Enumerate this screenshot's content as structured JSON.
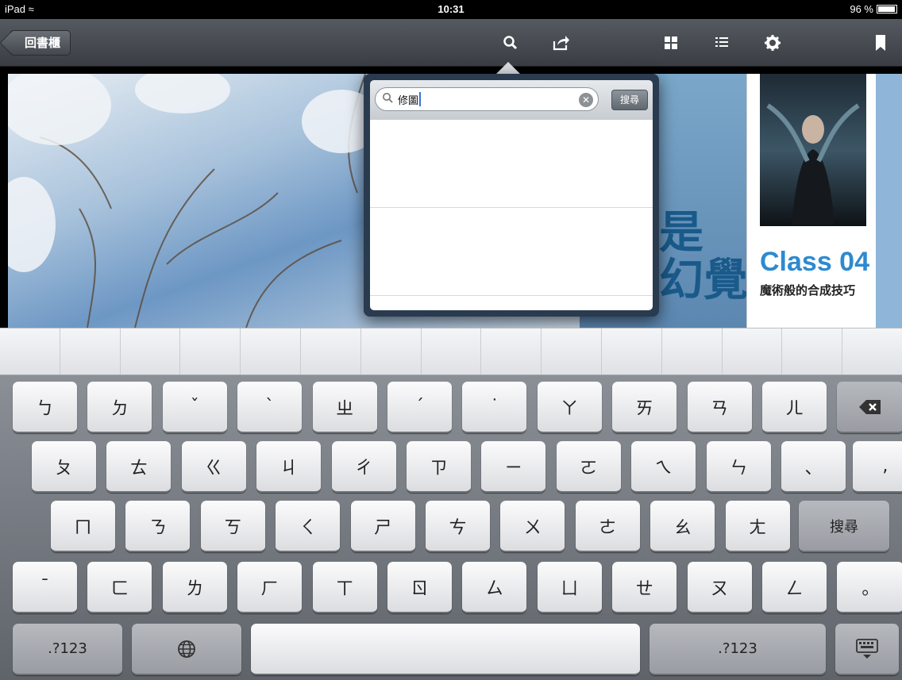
{
  "status_bar": {
    "device": "iPad",
    "time": "10:31",
    "battery": "96 %",
    "battery_level": 0.96
  },
  "toolbar": {
    "back_label": "回書櫃"
  },
  "magazine": {
    "title": "Class 04",
    "subtitle": "魔術般的合成技巧",
    "big_text": "是\n幻覺"
  },
  "search": {
    "query": "修圖",
    "button_label": "搜尋"
  },
  "keyboard": {
    "row1": [
      "ㄅ",
      "ㄉ",
      "ˇ",
      "ˋ",
      "ㄓ",
      "ˊ",
      "˙",
      "ㄚ",
      "ㄞ",
      "ㄢ",
      "ㄦ"
    ],
    "row2": [
      "ㄆ",
      "ㄊ",
      "ㄍ",
      "ㄐ",
      "ㄔ",
      "ㄗ",
      "ㄧ",
      "ㄛ",
      "ㄟ",
      "ㄣ",
      "、",
      ","
    ],
    "row3": [
      "ㄇ",
      "ㄋ",
      "ㄎ",
      "ㄑ",
      "ㄕ",
      "ㄘ",
      "ㄨ",
      "ㄜ",
      "ㄠ",
      "ㄤ"
    ],
    "row3_action": "搜尋",
    "row4": [
      "ˉ",
      "ㄈ",
      "ㄌ",
      "ㄏ",
      "ㄒ",
      "ㄖ",
      "ㄙ",
      "ㄩ",
      "ㄝ",
      "ㄡ",
      "ㄥ",
      "。"
    ],
    "numbers_label_left": ".?123",
    "numbers_label_right": ".?123"
  },
  "colors": {
    "accent": "#2d8ad0",
    "toolbar": "#44484e"
  }
}
